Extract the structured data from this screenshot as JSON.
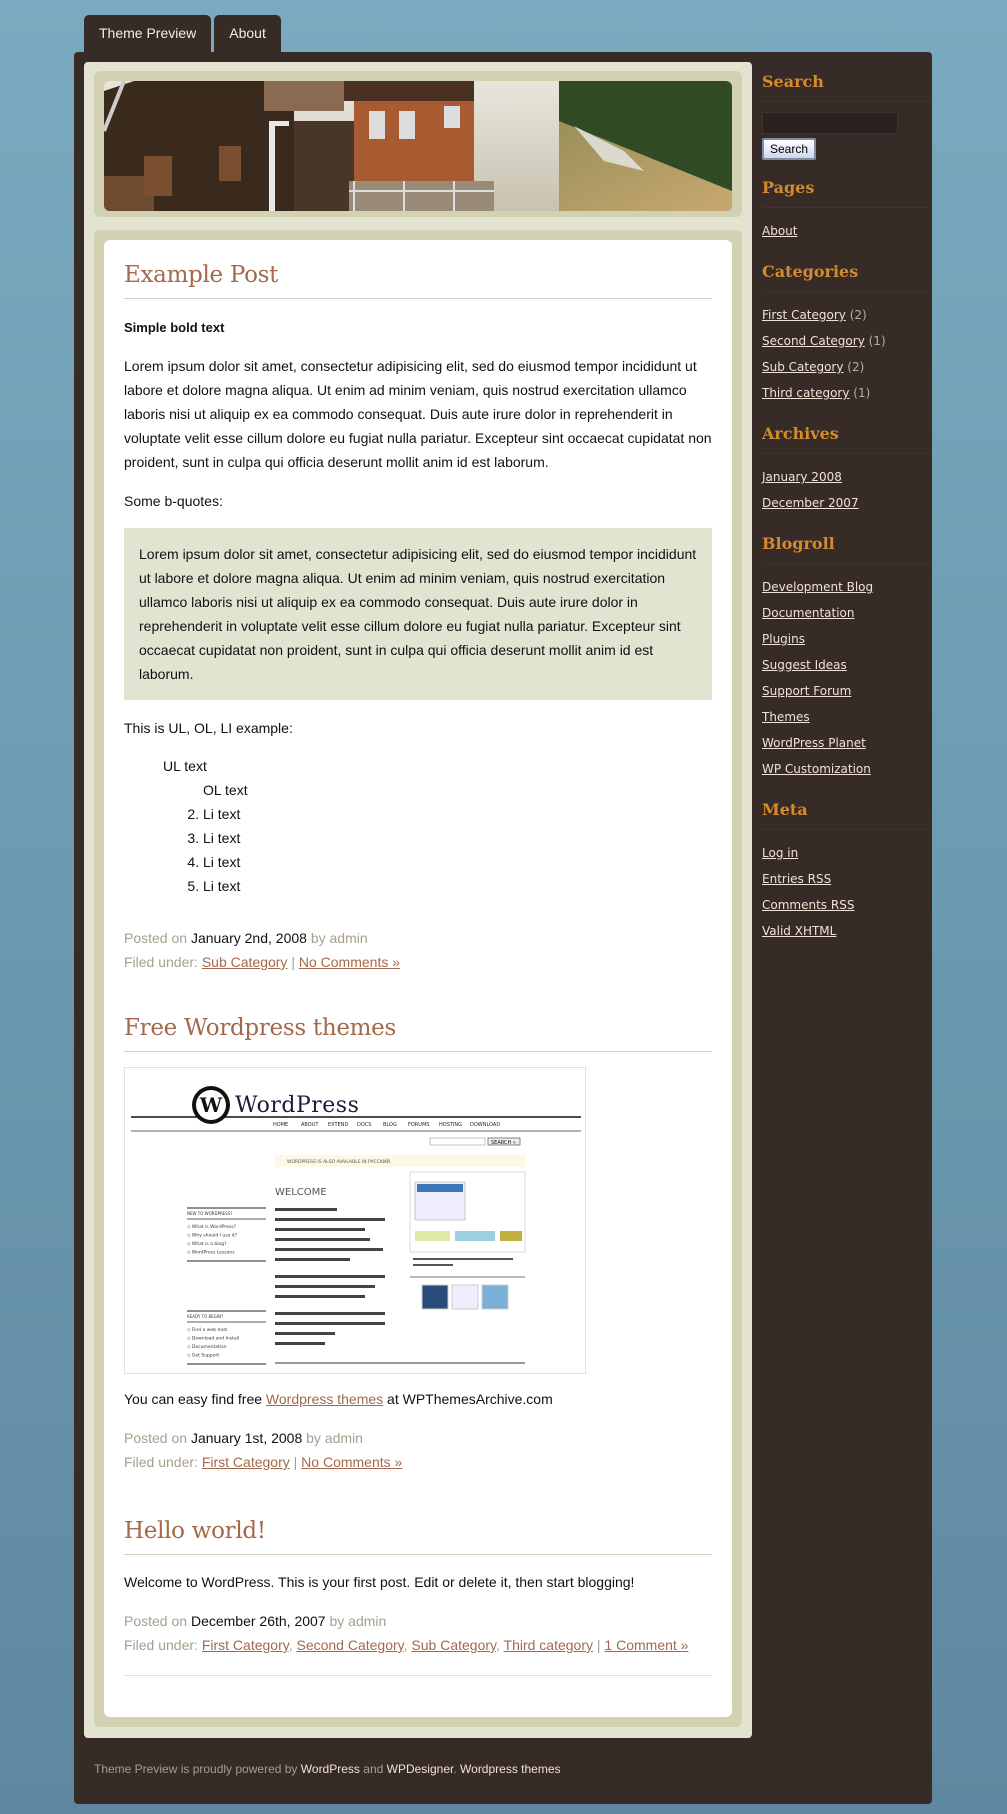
{
  "nav": {
    "tabs": [
      {
        "label": "Theme Preview"
      },
      {
        "label": "About"
      }
    ]
  },
  "posts": [
    {
      "title": "Example Post",
      "bold_text": "Simple bold text",
      "paragraph": "Lorem ipsum dolor sit amet, consectetur adipisicing elit, sed do eiusmod tempor incididunt ut labore et dolore magna aliqua. Ut enim ad minim veniam, quis nostrud exercitation ullamco laboris nisi ut aliquip ex ea commodo consequat. Duis aute irure dolor in reprehenderit in voluptate velit esse cillum dolore eu fugiat nulla pariatur. Excepteur sint occaecat cupidatat non proident, sunt in culpa qui officia deserunt mollit anim id est laborum.",
      "bquote_intro": "Some b-quotes:",
      "blockquote": "Lorem ipsum dolor sit amet, consectetur adipisicing elit, sed do eiusmod tempor incididunt ut labore et dolore magna aliqua. Ut enim ad minim veniam, quis nostrud exercitation ullamco laboris nisi ut aliquip ex ea commodo consequat. Duis aute irure dolor in reprehenderit in voluptate velit esse cillum dolore eu fugiat nulla pariatur. Excepteur sint occaecat cupidatat non proident, sunt in culpa qui officia deserunt mollit anim id est laborum.",
      "list_intro": "This is UL, OL, LI example:",
      "ul_text": "UL text",
      "ol_text": "OL text",
      "li_items": [
        "Li text",
        "Li text",
        "Li text",
        "Li text"
      ],
      "posted_on_label": "Posted on",
      "date": "January 2nd, 2008",
      "by_label": "by",
      "author": "admin",
      "filed_label": "Filed under:",
      "categories": [
        "Sub Category"
      ],
      "comments": "No Comments »"
    },
    {
      "title": "Free Wordpress themes",
      "text_before": "You can easy find free",
      "link": "Wordpress themes",
      "text_after": "at WPThemesArchive.com",
      "posted_on_label": "Posted on",
      "date": "January 1st, 2008",
      "by_label": "by",
      "author": "admin",
      "filed_label": "Filed under:",
      "categories": [
        "First Category"
      ],
      "comments": "No Comments »"
    },
    {
      "title": "Hello world!",
      "body": "Welcome to WordPress. This is your first post. Edit or delete it, then start blogging!",
      "posted_on_label": "Posted on",
      "date": "December 26th, 2007",
      "by_label": "by",
      "author": "admin",
      "filed_label": "Filed under:",
      "categories": [
        "First Category",
        "Second Category",
        "Sub Category",
        "Third category"
      ],
      "comments": "1 Comment »"
    }
  ],
  "wp_screenshot": {
    "logo": "WordPress",
    "menu": [
      "HOME",
      "ABOUT",
      "EXTEND",
      "DOCS",
      "BLOG",
      "FORUMS",
      "HOSTING",
      "DOWNLOAD"
    ],
    "search_button": "SEARCH »",
    "notice": "WORDPRESS IS ALSO AVAILABLE IN РУССКИЙ.",
    "welcome": "WELCOME",
    "new_heading": "NEW TO WORDPRESS?",
    "new_links": [
      "What is WordPress?",
      "Why should I use it?",
      "What is a blog?",
      "WordPress Lessons"
    ],
    "ready_heading": "READY TO BEGIN?",
    "ready_links": [
      "Find a web host",
      "Download and Install",
      "Documentation",
      "Get Support"
    ],
    "intro": "WordPress is a state-of-the-art semantic personal publishing platform with a focus on aesthetics, web standards, and usability. What a mouthful. WordPress is both free and priceless at the same time.",
    "intro2": "More simply, WordPress is what you use when you want to work with your blogging software, not fight it.",
    "intro3": "To get started with WordPress, set it up on a web host for the most flexibility or get a free blog on WordPress.com.",
    "current_theme": "Current Theme",
    "available_themes": "Available Themes",
    "caption": "WordPress' admin interface is one of the friendliest around."
  },
  "sidebar": {
    "search": {
      "title": "Search",
      "input_value": "",
      "button": "Search"
    },
    "pages": {
      "title": "Pages",
      "items": [
        {
          "label": "About"
        }
      ]
    },
    "categories": {
      "title": "Categories",
      "items": [
        {
          "label": "First Category",
          "count": "(2)"
        },
        {
          "label": "Second Category",
          "count": "(1)"
        },
        {
          "label": "Sub Category",
          "count": "(2)"
        },
        {
          "label": "Third category",
          "count": "(1)"
        }
      ]
    },
    "archives": {
      "title": "Archives",
      "items": [
        {
          "label": "January 2008"
        },
        {
          "label": "December 2007"
        }
      ]
    },
    "blogroll": {
      "title": "Blogroll",
      "items": [
        {
          "label": "Development Blog"
        },
        {
          "label": "Documentation"
        },
        {
          "label": "Plugins"
        },
        {
          "label": "Suggest Ideas"
        },
        {
          "label": "Support Forum"
        },
        {
          "label": "Themes"
        },
        {
          "label": "WordPress Planet"
        },
        {
          "label": "WP Customization"
        }
      ]
    },
    "meta": {
      "title": "Meta",
      "items": [
        {
          "label": "Log in"
        },
        {
          "label": "Entries RSS"
        },
        {
          "label": "Comments RSS"
        },
        {
          "label": "Valid XHTML"
        }
      ]
    }
  },
  "footer": {
    "prefix": "Theme Preview is proudly powered by",
    "link1": "WordPress",
    "and": "and",
    "link2": "WPDesigner",
    "sep": ".",
    "link3": "Wordpress themes"
  },
  "colors": {
    "background": "#6f9db3",
    "wrapper": "#372b27",
    "title_accent": "#a4694a",
    "widget_title": "#d48a2e",
    "panel": "#e3e3d1"
  }
}
